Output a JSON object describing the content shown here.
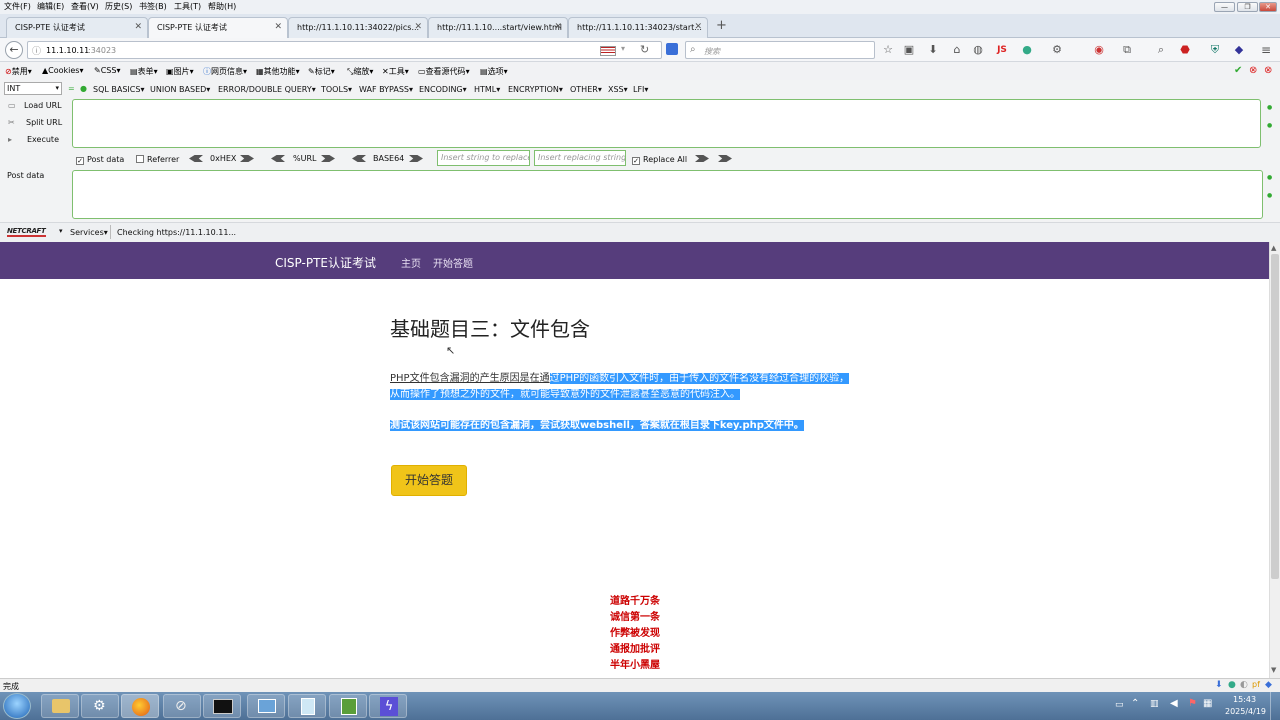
{
  "menubar": {
    "items": [
      "文件(F)",
      "编辑(E)",
      "查看(V)",
      "历史(S)",
      "书签(B)",
      "工具(T)",
      "帮助(H)"
    ]
  },
  "tabs": [
    {
      "label": "CISP-PTE 认证考试",
      "active": false
    },
    {
      "label": "CISP-PTE 认证考试",
      "active": true
    },
    {
      "label": "http://11.1.10.11:34022/pics...",
      "active": false
    },
    {
      "label": "http://11.1.10....start/view.html",
      "active": false
    },
    {
      "label": "http://11.1.10.11:34023/start...",
      "active": false
    }
  ],
  "navbar": {
    "url_host": "11.1.10.11",
    "url_port": ":34023",
    "search_placeholder": "搜索",
    "js_label": "JS"
  },
  "webdev_toolbar": {
    "items": [
      "禁用",
      "Cookies",
      "CSS",
      "表单",
      "图片",
      "网页信息",
      "其他功能",
      "标记",
      "缩放",
      "工具",
      "查看源代码",
      "选项"
    ]
  },
  "hackbar": {
    "type_select": "INT",
    "menus": [
      "SQL BASICS",
      "UNION BASED",
      "ERROR/DOUBLE QUERY",
      "TOOLS",
      "WAF BYPASS",
      "ENCODING",
      "HTML",
      "ENCRYPTION",
      "OTHER",
      "XSS",
      "LFI"
    ],
    "load_url": "Load URL",
    "split_url": "Split URL",
    "execute": "Execute",
    "post_data_checkbox": "Post data",
    "referrer_checkbox": "Referrer",
    "hex": "0xHEX",
    "url_enc": "%URL",
    "base64": "BASE64",
    "insert_placeholder": "Insert string to replace",
    "replacing_placeholder": "Insert replacing string",
    "replace_all": "Replace All",
    "post_data_label": "Post data"
  },
  "netcraft": {
    "logo": "NETCRAFT",
    "services": "Services",
    "checking": "Checking https://11.1.10.11..."
  },
  "page": {
    "brand": "CISP-PTE认证考试",
    "nav_home": "主页",
    "nav_start": "开始答题",
    "heading": "基础题目三：文件包含",
    "para1_a": "PHP文件包含漏洞的产生原因是在通",
    "para1_b": "过PHP的函数引入文件时，由于传入的文件名没有经过合理的校验，",
    "para1_c": "从而操作了预想之外的文件，就可能导致意外的文件泄露甚至恶意的代码注入。",
    "para2": "测试该网站可能存在的包含漏洞，尝试获取webshell，答案就在根目录下key.php文件中。",
    "start_button": "开始答题",
    "footer_lines": [
      "道路千万条",
      "诚信第一条",
      "作弊被发现",
      "通报加批评",
      "半年小黑屋"
    ]
  },
  "status": {
    "text": "完成"
  },
  "taskbar": {
    "time": "15:43",
    "date": "2025/4/19"
  },
  "colors": {
    "page_nav": "#563d7c",
    "button": "#f0c419",
    "selection": "#3399ff",
    "footer_text": "#cc0000"
  }
}
